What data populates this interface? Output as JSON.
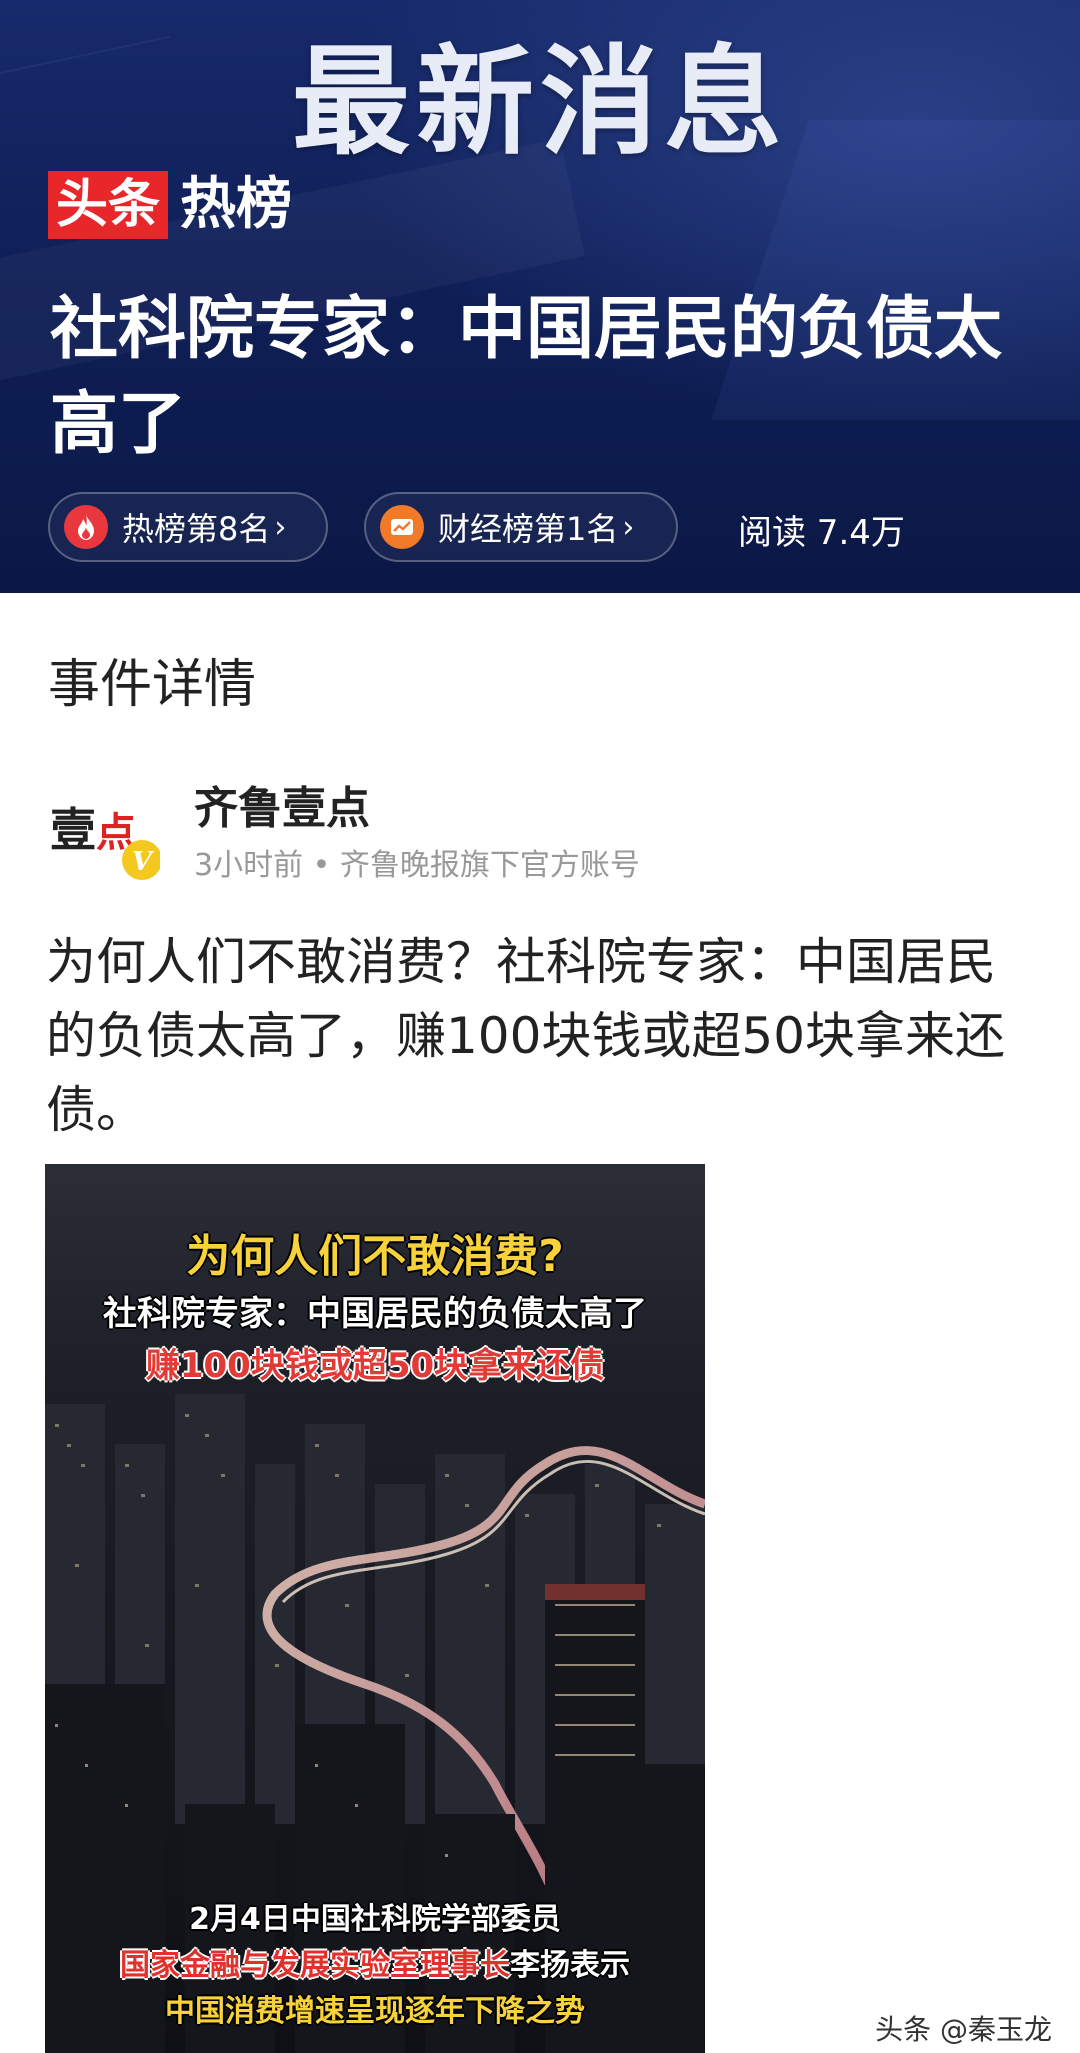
{
  "banner": {
    "title": "最新消息",
    "brand_red": "头条",
    "brand_white": "热榜"
  },
  "headline": "社科院专家：中国居民的负债太高了",
  "badges": [
    {
      "label": "热榜第8名",
      "icon": "flame-icon",
      "color": "#e8383d"
    },
    {
      "label": "财经榜第1名",
      "icon": "chart-icon",
      "color": "#f07a28"
    }
  ],
  "reads": "阅读 7.4万",
  "section_title": "事件详情",
  "post": {
    "author": "齐鲁壹点",
    "avatar_text": "壹点",
    "verified_mark": "V",
    "meta": "3小时前 • 齐鲁晚报旗下官方账号",
    "text": "为何人们不敢消费？社科院专家：中国居民的负债太高了，赚100块钱或超50块拿来还债。"
  },
  "video": {
    "caption_title": "为何人们不敢消费?",
    "caption_sub": "社科院专家：中国居民的负债太高了",
    "caption_red": "赚100块钱或超50块拿来还债",
    "caption_bottom1": "2月4日中国社科院学部委员",
    "caption_bottom2_red": "国家金融与发展实验室理事长",
    "caption_bottom2_rest": "李扬表示",
    "caption_bottom3": "中国消费增速呈现逐年下降之势"
  },
  "watermark": "头条 @秦玉龙"
}
